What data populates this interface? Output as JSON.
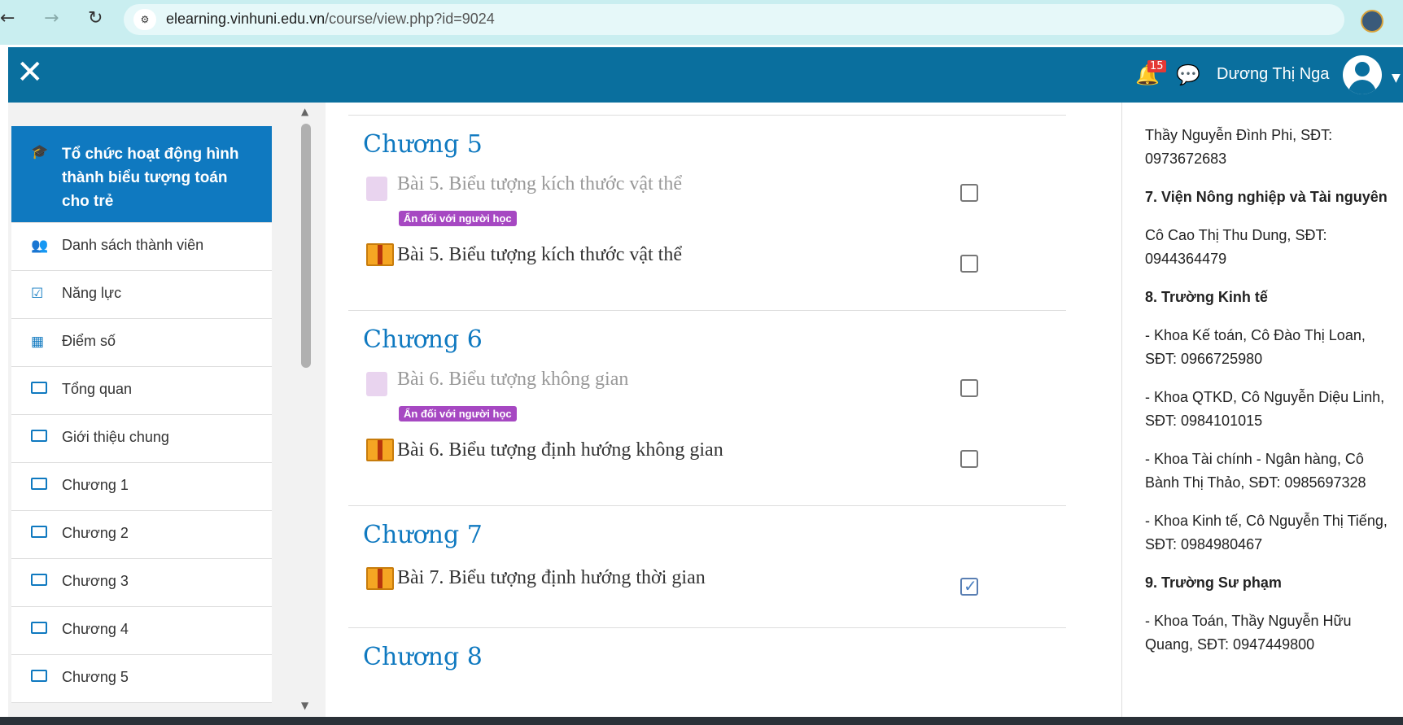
{
  "browser": {
    "url_domain": "elearning.vinhuni.edu.vn",
    "url_path": "/course/view.php?id=9024",
    "back_icon": "arrow-left-icon",
    "forward_icon": "arrow-right-icon",
    "reload_icon": "reload-icon"
  },
  "header": {
    "close_label": "✕",
    "notification_count": "15",
    "username": "Dương Thị Nga"
  },
  "sidebar": {
    "course_title": "Tổ chức hoạt động hình thành biểu tượng toán cho trẻ",
    "items": [
      {
        "label": "Danh sách thành viên",
        "icon": "users-icon"
      },
      {
        "label": "Năng lực",
        "icon": "checkbox-icon"
      },
      {
        "label": "Điểm số",
        "icon": "table-icon"
      },
      {
        "label": "Tổng quan",
        "icon": "folder-icon"
      },
      {
        "label": "Giới thiệu chung",
        "icon": "folder-icon"
      },
      {
        "label": "Chương 1",
        "icon": "folder-icon"
      },
      {
        "label": "Chương 2",
        "icon": "folder-icon"
      },
      {
        "label": "Chương 3",
        "icon": "folder-icon"
      },
      {
        "label": "Chương 4",
        "icon": "folder-icon"
      },
      {
        "label": "Chương 5",
        "icon": "folder-icon"
      }
    ]
  },
  "main": {
    "sections": [
      {
        "title": "Chương 5",
        "activities": [
          {
            "name": "Bài 5. Biểu tượng kích thước vật thể",
            "type": "page",
            "hidden_badge": "Ẩn đối với người học",
            "completed": false
          },
          {
            "name": "Bài 5. Biểu tượng kích thước vật thể",
            "type": "package",
            "completed": false
          }
        ]
      },
      {
        "title": "Chương 6",
        "activities": [
          {
            "name": "Bài 6. Biểu tượng không gian",
            "type": "page",
            "hidden_badge": "Ẩn đối với người học",
            "completed": false
          },
          {
            "name": "Bài 6. Biểu tượng định hướng không gian",
            "type": "package",
            "completed": false
          }
        ]
      },
      {
        "title": "Chương 7",
        "activities": [
          {
            "name": "Bài 7. Biểu tượng định hướng thời gian",
            "type": "package",
            "completed": true
          }
        ]
      },
      {
        "title": "Chương 8",
        "activities": []
      }
    ]
  },
  "rightpanel": {
    "blocks": [
      {
        "heading": "",
        "text": "  Thầy Nguyễn Đình Phi, SĐT: 0973672683"
      },
      {
        "heading": "7. Viện Nông nghiệp và Tài nguyên",
        "text": ""
      },
      {
        "heading": "",
        "text": "  Cô Cao Thị Thu Dung, SĐT: 0944364479"
      },
      {
        "heading": "8. Trường Kinh tế",
        "text": ""
      },
      {
        "heading": "",
        "text": "- Khoa Kế toán, Cô Đào Thị Loan, SĐT: 0966725980"
      },
      {
        "heading": "",
        "text": "- Khoa QTKD, Cô Nguyễn Diệu Linh, SĐT: 0984101015"
      },
      {
        "heading": "",
        "text": "- Khoa Tài chính - Ngân hàng, Cô Bành Thị Thảo, SĐT: 0985697328"
      },
      {
        "heading": "",
        "text": "- Khoa Kinh tế, Cô Nguyễn Thị Tiếng, SĐT: 0984980467"
      },
      {
        "heading": "9. Trường Sư phạm",
        "text": ""
      },
      {
        "heading": "",
        "text": "- Khoa Toán, Thầy Nguyễn Hữu Quang, SĐT: 0947449800"
      }
    ]
  },
  "colors": {
    "accent": "#0f79c0",
    "header_bg": "#0a6f9e",
    "hidden_badge": "#a648c2"
  }
}
